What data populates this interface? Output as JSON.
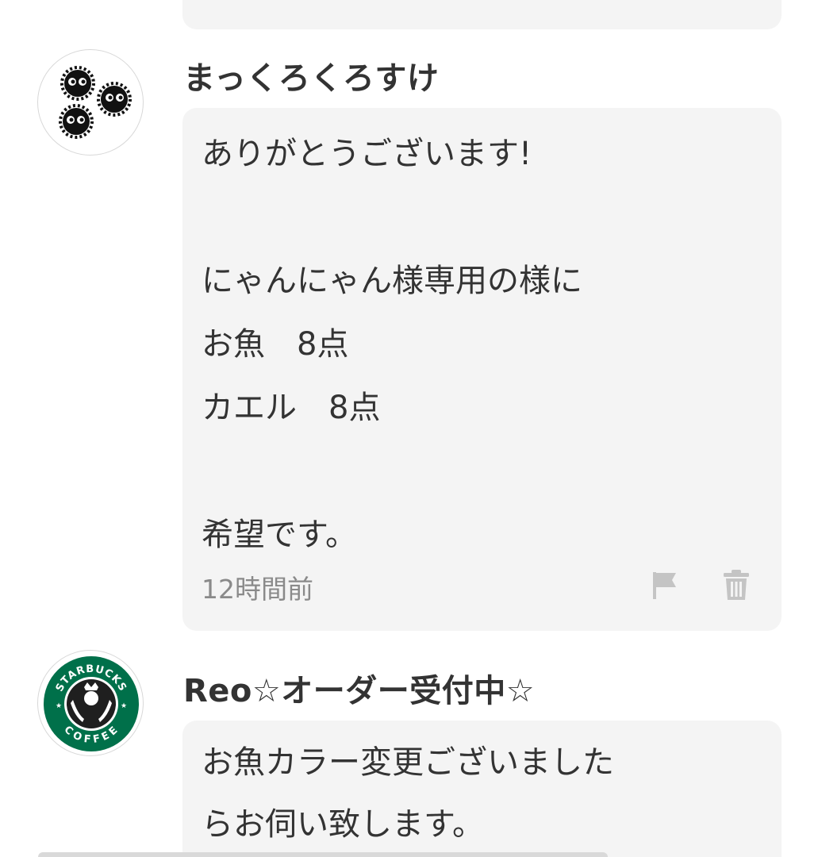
{
  "comments": [
    {
      "username": "まっくろくろすけ",
      "avatar_icon": "soot-sprites-icon",
      "message": "ありがとうございます!\n\nにゃんにゃん様専用の様に\nお魚　8点\nカエル　8点\n\n希望です。",
      "timestamp": "12時間前",
      "actions": [
        "flag-icon",
        "trash-icon"
      ]
    },
    {
      "username": "Reo☆オーダー受付中☆",
      "avatar_icon": "starbucks-logo-icon",
      "avatar_text_top": "STARBUCKS",
      "avatar_text_bottom": "COFFEE",
      "message": "お魚カラー変更ございました\nらお伺い致します。"
    }
  ],
  "colors": {
    "bubble_bg": "#f4f4f4",
    "text": "#333333",
    "timestamp": "#8a8a8a",
    "icon": "#c4c4c4",
    "starbucks_green": "#00704a"
  }
}
